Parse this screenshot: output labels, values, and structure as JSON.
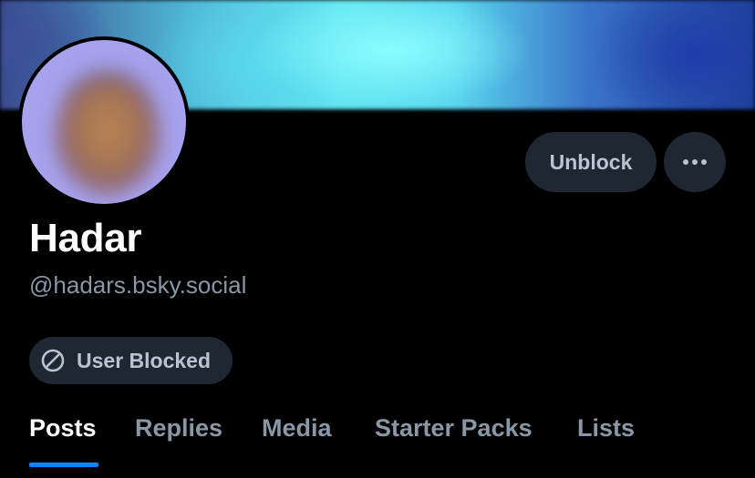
{
  "profile": {
    "display_name": "Hadar",
    "handle": "@hadars.bsky.social",
    "status_badge": "User Blocked"
  },
  "actions": {
    "unblock_label": "Unblock",
    "more_icon": "ellipsis-icon"
  },
  "tabs": [
    {
      "label": "Posts",
      "active": true
    },
    {
      "label": "Replies",
      "active": false
    },
    {
      "label": "Media",
      "active": false
    },
    {
      "label": "Starter Packs",
      "active": false
    },
    {
      "label": "Lists",
      "active": false
    }
  ],
  "colors": {
    "background": "#000000",
    "button_bg": "#1e2732",
    "muted_text": "#8a97a6",
    "accent": "#1083fe"
  }
}
